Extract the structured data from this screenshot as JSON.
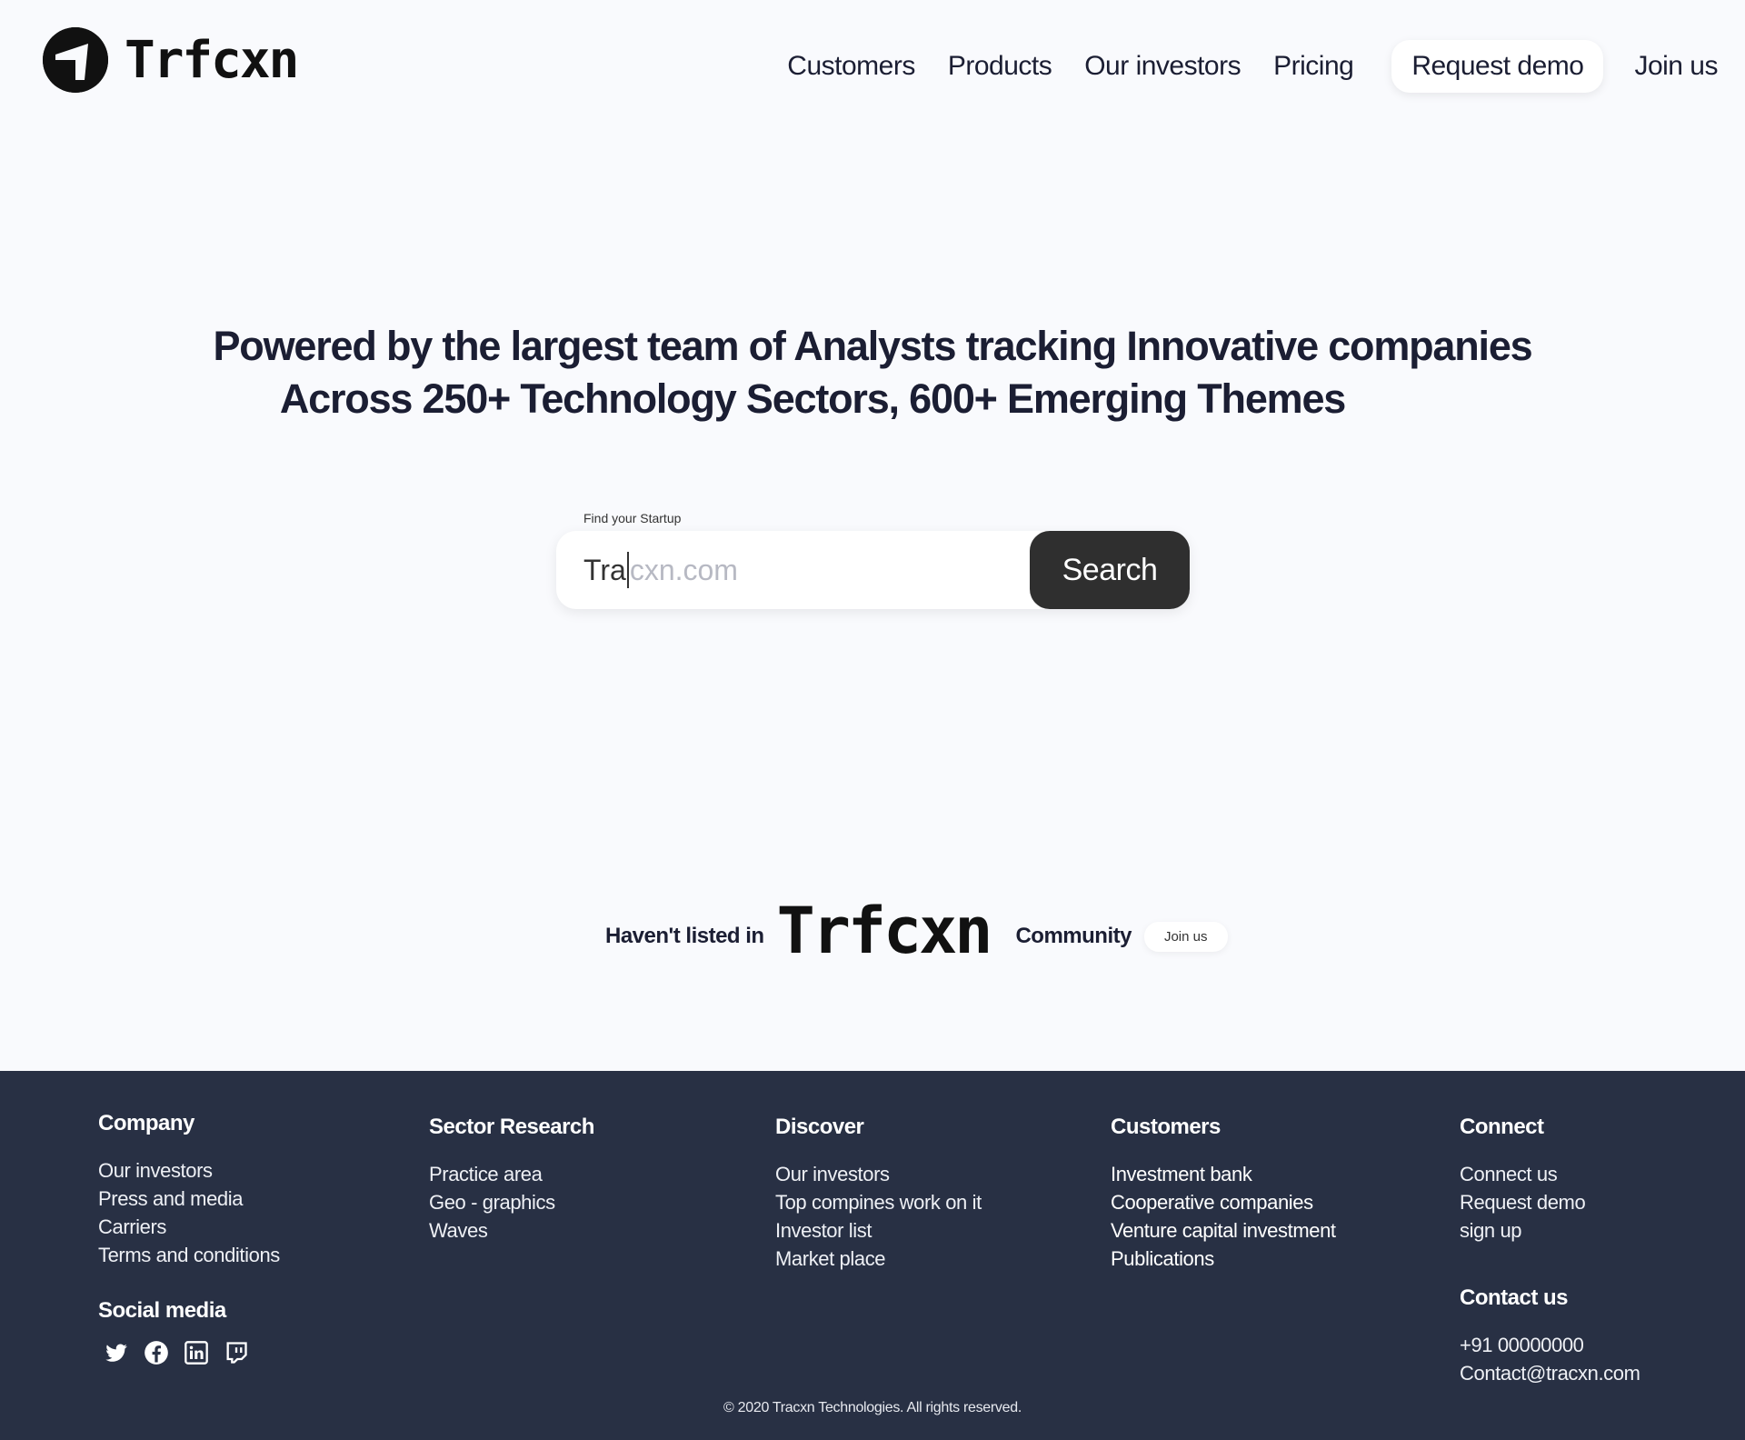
{
  "header": {
    "logo_text": "Trfcxn",
    "nav": [
      "Customers",
      "Products",
      "Our investors",
      "Pricing"
    ],
    "request_demo": "Request demo",
    "join_us": "Join us"
  },
  "hero": {
    "line1": "Powered by the largest team of Analysts tracking Innovative companies",
    "line2": "Across 250+ Technology Sectors, 600+ Emerging Themes"
  },
  "search": {
    "label": "Find your Startup",
    "typed_value": "Tra",
    "placeholder_rest": "cxn.com",
    "button": "Search"
  },
  "community": {
    "prefix": "Haven't listed in",
    "logo_text": "Trfcxn",
    "suffix": "Community",
    "join": "Join us"
  },
  "footer": {
    "company": {
      "title": "Company",
      "links": [
        "Our investors",
        "Press and media",
        "Carriers",
        "Terms and conditions"
      ]
    },
    "sector": {
      "title": "Sector Research",
      "links": [
        "Practice area",
        "Geo - graphics",
        "Waves"
      ]
    },
    "discover": {
      "title": "Discover",
      "links": [
        "Our investors",
        "Top compines work on it",
        "Investor list",
        "Market place"
      ]
    },
    "customers": {
      "title": "Customers",
      "links": [
        "Investment bank",
        "Cooperative companies",
        "Venture capital investment",
        "Publications"
      ]
    },
    "connect": {
      "title": "Connect",
      "links": [
        "Connect us",
        "Request demo",
        "sign up"
      ]
    },
    "social": {
      "title": "Social media",
      "icons": [
        "twitter-icon",
        "facebook-icon",
        "linkedin-icon",
        "twitch-icon"
      ]
    },
    "contact": {
      "title": "Contact us",
      "phone": "+91 00000000",
      "email": "Contact@tracxn.com"
    },
    "copyright": "© 2020 Tracxn Technologies. All rights reserved."
  },
  "colors": {
    "background": "#f9fafd",
    "text_dark": "#1b1e33",
    "search_button": "#2f2f2f",
    "footer_bg": "#283044"
  }
}
